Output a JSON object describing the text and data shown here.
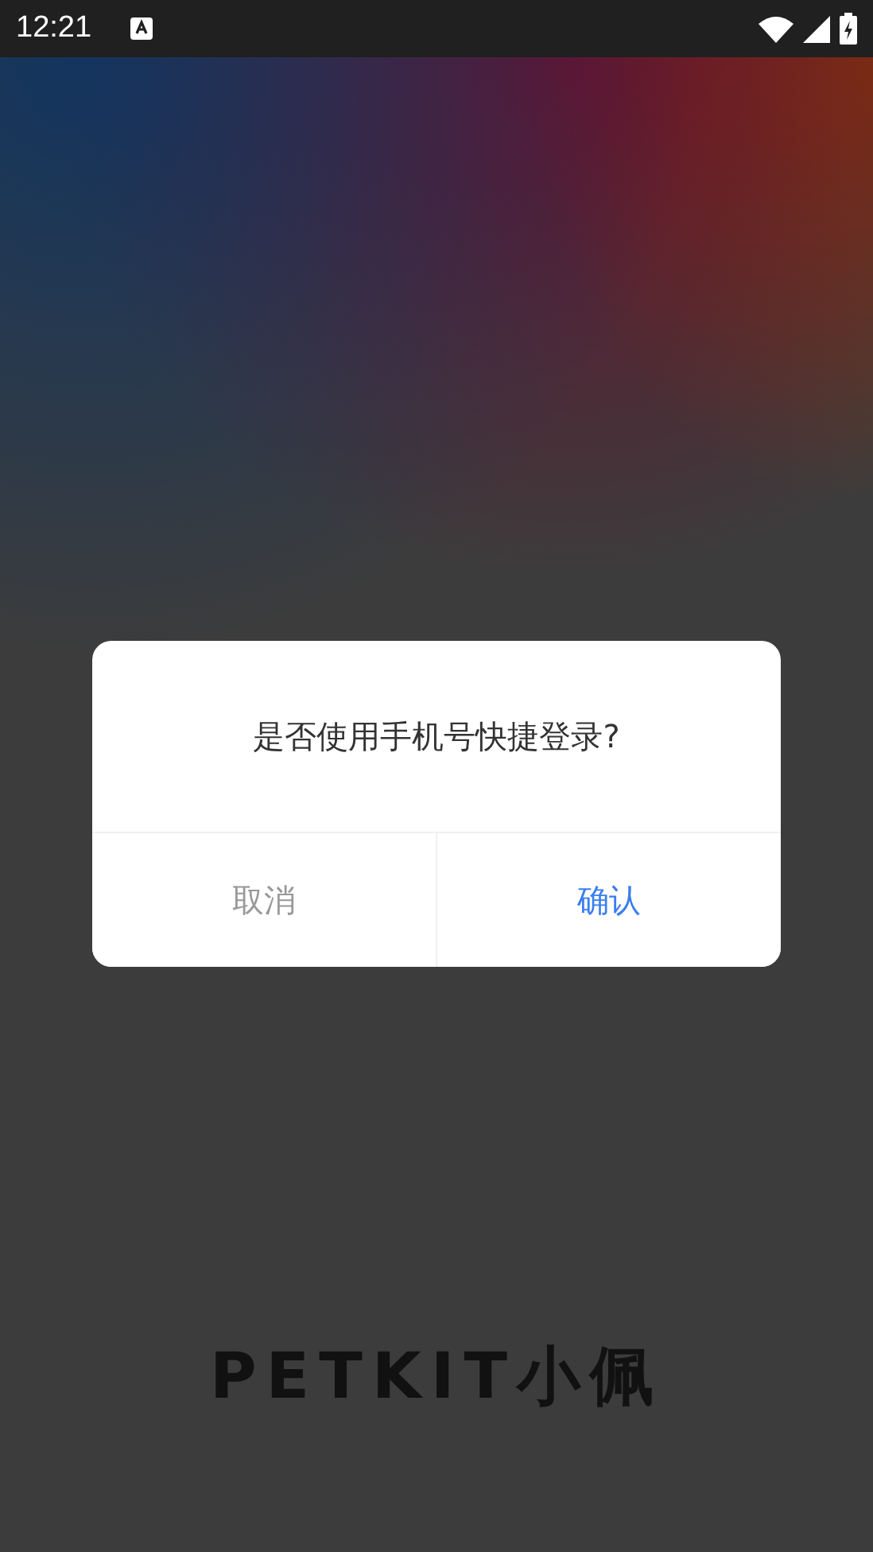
{
  "status_bar": {
    "time": "12:21"
  },
  "dialog": {
    "message": "是否使用手机号快捷登录?",
    "buttons": [
      {
        "label": "取消",
        "kind": "cancel"
      },
      {
        "label": "确认",
        "kind": "confirm"
      }
    ]
  },
  "logo": {
    "text": "PETKIT小佩"
  }
}
